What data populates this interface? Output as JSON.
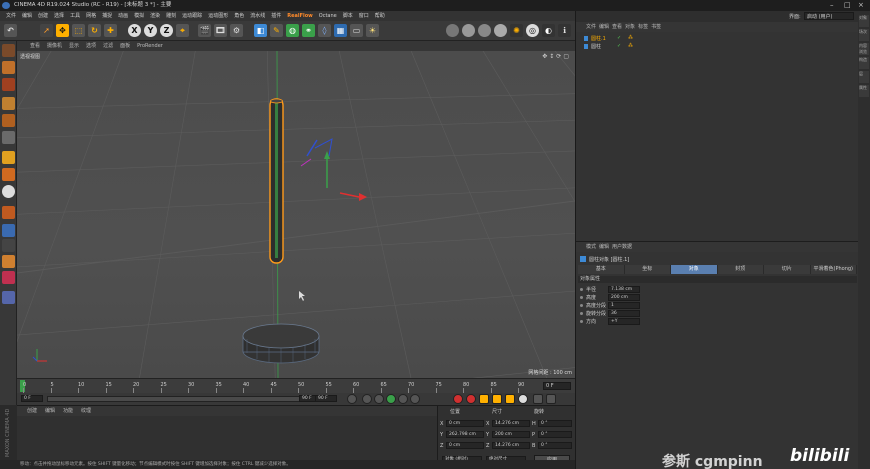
{
  "window": {
    "title": "CINEMA 4D R19.024 Studio (RC - R19) - [未标题 3 *] - 主要"
  },
  "menubar": {
    "items": [
      "文件",
      "编辑",
      "创建",
      "选择",
      "工具",
      "网格",
      "捕捉",
      "动画",
      "模拟",
      "渲染",
      "雕刻",
      "运动跟踪",
      "运动图形",
      "角色",
      "流水线",
      "插件",
      "RealFlow",
      "Octane",
      "脚本",
      "窗口",
      "帮助"
    ]
  },
  "layout": {
    "label": "界面:",
    "value": "启动 (用户)"
  },
  "toolbar": {
    "undo_icon": "undo-icon",
    "axis_x": "X",
    "axis_y": "Y",
    "axis_z": "Z",
    "colors": {
      "accent": "#ffb000",
      "cube": "#3d8ad6",
      "green": "#3aa04a"
    }
  },
  "viewport": {
    "menu": [
      "查看",
      "摄像机",
      "显示",
      "选项",
      "过滤",
      "面板",
      "ProRender"
    ],
    "label": "透视视图",
    "grid_info": "网格间距 : 100 cm"
  },
  "timeline": {
    "ticks": [
      "0",
      "5",
      "10",
      "15",
      "20",
      "25",
      "30",
      "35",
      "40",
      "45",
      "50",
      "55",
      "60",
      "65",
      "70",
      "75",
      "80",
      "85",
      "90"
    ],
    "frame_right": "0 F",
    "start": "0 F",
    "end_a": "90 F",
    "end_b": "90 F"
  },
  "material_panel": {
    "menu": [
      "创建",
      "编辑",
      "功能",
      "纹理"
    ]
  },
  "coords": {
    "headers": [
      "位置",
      "尺寸",
      "旋转"
    ],
    "rows": [
      {
        "axis": "X",
        "pos": "0 cm",
        "size_axis": "X",
        "size": "14.276 cm",
        "rot_axis": "H",
        "rot": "0 °"
      },
      {
        "axis": "Y",
        "pos": "262.798 cm",
        "size_axis": "Y",
        "size": "200 cm",
        "rot_axis": "P",
        "rot": "0 °"
      },
      {
        "axis": "Z",
        "pos": "0 cm",
        "size_axis": "Z",
        "size": "14.276 cm",
        "rot_axis": "B",
        "rot": "0 °"
      }
    ],
    "mode": "对象 (相对)",
    "size_mode": "绝对尺寸",
    "apply": "应用"
  },
  "status": {
    "text": "移动：点击并拖动鼠标移动元素。按住 SHIFT 键量化移动；节点编辑模式时按住 SHIFT 键增加选择对象；按住 CTRL 键减少选择对象。"
  },
  "object_manager": {
    "menu": [
      "文件",
      "编辑",
      "查看",
      "对象",
      "标签",
      "书签"
    ],
    "objects": [
      "圆柱.1",
      "圆柱"
    ]
  },
  "attributes": {
    "menu": [
      "模式",
      "编辑",
      "用户数据"
    ],
    "object_title": "圆柱对象 [圆柱.1]",
    "tabs": [
      "基本",
      "坐标",
      "对象",
      "封顶",
      "切片",
      "平滑着色(Phong)"
    ],
    "active_tab": 2,
    "section": "对象属性",
    "fields": [
      {
        "label": "半径",
        "value": "7.138 cm"
      },
      {
        "label": "高度",
        "value": "200 cm"
      },
      {
        "label": "高度分段",
        "value": "1"
      },
      {
        "label": "旋转分段",
        "value": "36"
      },
      {
        "label": "方向",
        "value": "+Y"
      }
    ]
  },
  "side_tabs": [
    "对象",
    "场次",
    "内容浏览器",
    "构造",
    "层",
    "属性"
  ],
  "watermark": {
    "text": "参斯 cgmpinn",
    "brand": "bilibili"
  },
  "left_tools": [
    "model-icon",
    "object-icon",
    "texture-icon",
    "point-icon",
    "edge-icon",
    "polygon-icon",
    "axis-icon",
    "snap-icon",
    "workplane-icon",
    "sculpt-icon"
  ]
}
